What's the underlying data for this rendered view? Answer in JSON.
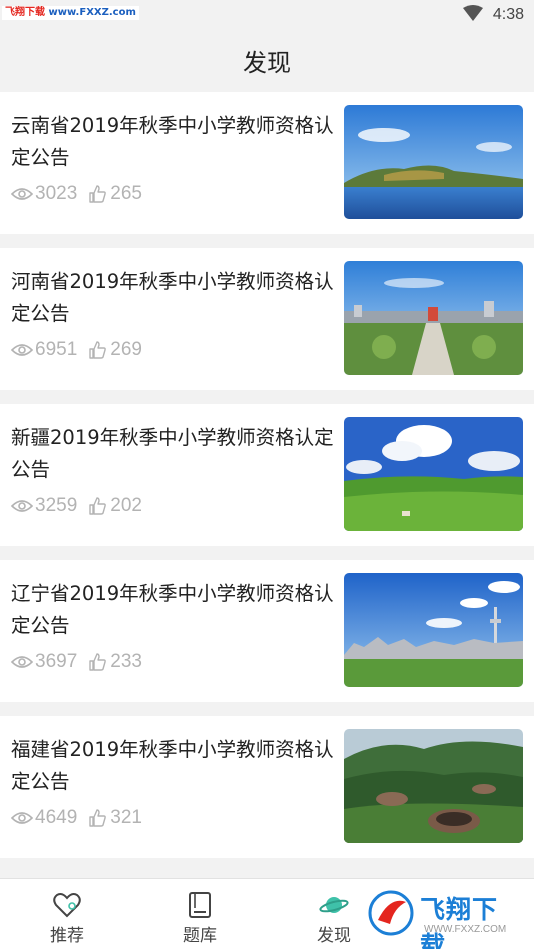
{
  "status_bar": {
    "watermark": {
      "part1": "飞翔下载 ",
      "part2": "www.FXXZ.com"
    },
    "time": "4:38"
  },
  "header": {
    "title": "发现"
  },
  "articles": [
    {
      "title": "云南省2019年秋季中小学教师资格认定公告",
      "views": "3023",
      "likes": "265"
    },
    {
      "title": "河南省2019年秋季中小学教师资格认定公告",
      "views": "6951",
      "likes": "269"
    },
    {
      "title": "新疆2019年秋季中小学教师资格认定公告",
      "views": "3259",
      "likes": "202"
    },
    {
      "title": "辽宁省2019年秋季中小学教师资格认定公告",
      "views": "3697",
      "likes": "233"
    },
    {
      "title": "福建省2019年秋季中小学教师资格认定公告",
      "views": "4649",
      "likes": "321"
    }
  ],
  "tab_bar": {
    "tabs": [
      {
        "label": "推荐",
        "icon": "heart-icon"
      },
      {
        "label": "题库",
        "icon": "book-icon"
      },
      {
        "label": "发现",
        "icon": "planet-icon",
        "active": true
      }
    ],
    "active_color": "#3fc1a9"
  },
  "watermark_bottom": {
    "name": "飞翔下载",
    "url": "WWW.FXXZ.COM"
  }
}
